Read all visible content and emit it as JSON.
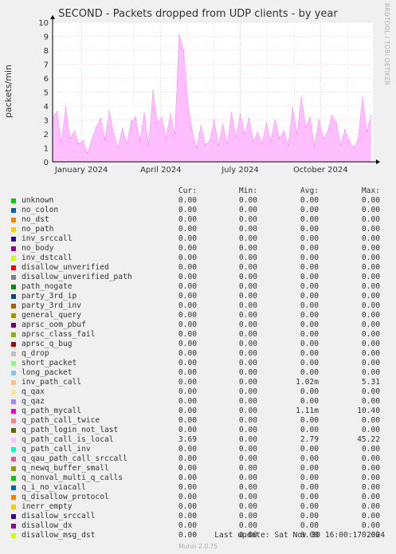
{
  "title": "SECOND - Packets dropped from UDP clients - by year",
  "watermark": "RRDTOOL / TOBI OETIKER",
  "footer": {
    "last_update": "Last update: Sat Nov 30 16:00:17 2024",
    "munin": "Munin 2.0.75"
  },
  "legend": {
    "headers": {
      "cur": "Cur:",
      "min": "Min:",
      "avg": "Avg:",
      "max": "Max:"
    },
    "rows": [
      {
        "name": "unknown",
        "color": "#00cc00",
        "cur": "0.00",
        "min": "0.00",
        "avg": "0.00",
        "max": "0.00"
      },
      {
        "name": "no_colon",
        "color": "#0066b3",
        "cur": "0.00",
        "min": "0.00",
        "avg": "0.00",
        "max": "0.00"
      },
      {
        "name": "no_dst",
        "color": "#ff8000",
        "cur": "0.00",
        "min": "0.00",
        "avg": "0.00",
        "max": "0.00"
      },
      {
        "name": "no_path",
        "color": "#ffcc00",
        "cur": "0.00",
        "min": "0.00",
        "avg": "0.00",
        "max": "0.00"
      },
      {
        "name": "inv_srccall",
        "color": "#330099",
        "cur": "0.00",
        "min": "0.00",
        "avg": "0.00",
        "max": "0.00"
      },
      {
        "name": "no_body",
        "color": "#990099",
        "cur": "0.00",
        "min": "0.00",
        "avg": "0.00",
        "max": "0.00"
      },
      {
        "name": "inv_dstcall",
        "color": "#ccff00",
        "cur": "0.00",
        "min": "0.00",
        "avg": "0.00",
        "max": "0.00"
      },
      {
        "name": "disallow_unverified",
        "color": "#ff0000",
        "cur": "0.00",
        "min": "0.00",
        "avg": "0.00",
        "max": "0.00"
      },
      {
        "name": "disallow_unverified_path",
        "color": "#808080",
        "cur": "0.00",
        "min": "0.00",
        "avg": "0.00",
        "max": "0.00"
      },
      {
        "name": "path_nogate",
        "color": "#008f00",
        "cur": "0.00",
        "min": "0.00",
        "avg": "0.00",
        "max": "0.00"
      },
      {
        "name": "party_3rd_ip",
        "color": "#00487d",
        "cur": "0.00",
        "min": "0.00",
        "avg": "0.00",
        "max": "0.00"
      },
      {
        "name": "party_3rd_inv",
        "color": "#b35a00",
        "cur": "0.00",
        "min": "0.00",
        "avg": "0.00",
        "max": "0.00"
      },
      {
        "name": "general_query",
        "color": "#b38f00",
        "cur": "0.00",
        "min": "0.00",
        "avg": "0.00",
        "max": "0.00"
      },
      {
        "name": "aprsc_oom_pbuf",
        "color": "#6b006b",
        "cur": "0.00",
        "min": "0.00",
        "avg": "0.00",
        "max": "0.00"
      },
      {
        "name": "aprsc_class_fail",
        "color": "#8fb300",
        "cur": "0.00",
        "min": "0.00",
        "avg": "0.00",
        "max": "0.00"
      },
      {
        "name": "aprsc_q_bug",
        "color": "#b30000",
        "cur": "0.00",
        "min": "0.00",
        "avg": "0.00",
        "max": "0.00"
      },
      {
        "name": "q_drop",
        "color": "#bebebe",
        "cur": "0.00",
        "min": "0.00",
        "avg": "0.00",
        "max": "0.00"
      },
      {
        "name": "short_packet",
        "color": "#80ff80",
        "cur": "0.00",
        "min": "0.00",
        "avg": "0.00",
        "max": "0.00"
      },
      {
        "name": "long_packet",
        "color": "#80c9ff",
        "cur": "0.00",
        "min": "0.00",
        "avg": "0.00",
        "max": "0.00"
      },
      {
        "name": "inv_path_call",
        "color": "#ffc080",
        "cur": "0.00",
        "min": "0.00",
        "avg": "1.02m",
        "max": "5.31"
      },
      {
        "name": "q_qax",
        "color": "#ffe680",
        "cur": "0.00",
        "min": "0.00",
        "avg": "0.00",
        "max": "0.00"
      },
      {
        "name": "q_qaz",
        "color": "#aa80ff",
        "cur": "0.00",
        "min": "0.00",
        "avg": "0.00",
        "max": "0.00"
      },
      {
        "name": "q_path_mycall",
        "color": "#ee00cc",
        "cur": "0.00",
        "min": "0.00",
        "avg": "1.11m",
        "max": "10.40"
      },
      {
        "name": "q_path_call_twice",
        "color": "#ff8080",
        "cur": "0.00",
        "min": "0.00",
        "avg": "0.00",
        "max": "0.00"
      },
      {
        "name": "q_path_login_not_last",
        "color": "#666600",
        "cur": "0.00",
        "min": "0.00",
        "avg": "0.00",
        "max": "0.00"
      },
      {
        "name": "q_path_call_is_local",
        "color": "#ffbfff",
        "cur": "3.69",
        "min": "0.00",
        "avg": "2.79",
        "max": "45.22"
      },
      {
        "name": "q_path_call_inv",
        "color": "#00ffcc",
        "cur": "0.00",
        "min": "0.00",
        "avg": "0.00",
        "max": "0.00"
      },
      {
        "name": "q_qau_path_call_srccall",
        "color": "#cc6699",
        "cur": "0.00",
        "min": "0.00",
        "avg": "0.00",
        "max": "0.00"
      },
      {
        "name": "q_newq_buffer_small",
        "color": "#999900",
        "cur": "0.00",
        "min": "0.00",
        "avg": "0.00",
        "max": "0.00"
      },
      {
        "name": "q_nonval_multi_q_calls",
        "color": "#00cc00",
        "cur": "0.00",
        "min": "0.00",
        "avg": "0.00",
        "max": "0.00"
      },
      {
        "name": "q_i_no_viacall",
        "color": "#0066b3",
        "cur": "0.00",
        "min": "0.00",
        "avg": "0.00",
        "max": "0.00"
      },
      {
        "name": "q_disallow_protocol",
        "color": "#ff8000",
        "cur": "0.00",
        "min": "0.00",
        "avg": "0.00",
        "max": "0.00"
      },
      {
        "name": "inerr_empty",
        "color": "#ffcc00",
        "cur": "0.00",
        "min": "0.00",
        "avg": "0.00",
        "max": "0.00"
      },
      {
        "name": "disallow_srccall",
        "color": "#330099",
        "cur": "0.00",
        "min": "0.00",
        "avg": "0.00",
        "max": "0.00"
      },
      {
        "name": "disallow_dx",
        "color": "#990099",
        "cur": "0.00",
        "min": "0.00",
        "avg": "0.00",
        "max": "0.00"
      },
      {
        "name": "disallow_msg_dst",
        "color": "#ccff00",
        "cur": "0.00",
        "min": "0.00",
        "avg": "0.00",
        "max": "0.00"
      }
    ]
  },
  "chart_data": {
    "type": "area",
    "title": "SECOND - Packets dropped from UDP clients - by year",
    "ylabel": "packets/min",
    "xlabel": "",
    "ylim": [
      0,
      10
    ],
    "yticks": [
      0,
      1,
      2,
      3,
      4,
      5,
      6,
      7,
      8,
      9,
      10
    ],
    "xlim": [
      "2023-11-29",
      "2024-11-30"
    ],
    "xticks": [
      {
        "label": "January 2024",
        "date": "2024-01-01"
      },
      {
        "label": "April 2024",
        "date": "2024-04-01"
      },
      {
        "label": "July 2024",
        "date": "2024-07-01"
      },
      {
        "label": "October 2024",
        "date": "2024-10-01"
      }
    ],
    "grid": true,
    "fill_color": "#ffbfff",
    "line_color": "#ff80ff",
    "series": [
      {
        "name": "q_path_call_is_local",
        "points": [
          [
            "2023-11-29",
            3.2
          ],
          [
            "2023-12-04",
            3.6
          ],
          [
            "2023-12-09",
            1.4
          ],
          [
            "2023-12-14",
            3.9
          ],
          [
            "2023-12-19",
            1.7
          ],
          [
            "2023-12-24",
            2.2
          ],
          [
            "2023-12-29",
            1.3
          ],
          [
            "2024-01-03",
            1.5
          ],
          [
            "2024-01-08",
            0.6
          ],
          [
            "2024-01-13",
            1.6
          ],
          [
            "2024-01-18",
            2.5
          ],
          [
            "2024-01-23",
            3.1
          ],
          [
            "2024-01-28",
            1.6
          ],
          [
            "2024-02-02",
            3.6
          ],
          [
            "2024-02-07",
            2.0
          ],
          [
            "2024-02-12",
            1.0
          ],
          [
            "2024-02-17",
            2.4
          ],
          [
            "2024-02-22",
            1.3
          ],
          [
            "2024-02-27",
            2.9
          ],
          [
            "2024-03-03",
            3.2
          ],
          [
            "2024-03-08",
            1.5
          ],
          [
            "2024-03-13",
            3.5
          ],
          [
            "2024-03-18",
            1.2
          ],
          [
            "2024-03-23",
            5.1
          ],
          [
            "2024-03-28",
            2.8
          ],
          [
            "2024-04-02",
            3.2
          ],
          [
            "2024-04-07",
            1.7
          ],
          [
            "2024-04-12",
            3.4
          ],
          [
            "2024-04-17",
            2.0
          ],
          [
            "2024-04-22",
            9.1
          ],
          [
            "2024-04-27",
            8.0
          ],
          [
            "2024-05-02",
            4.2
          ],
          [
            "2024-05-07",
            2.2
          ],
          [
            "2024-05-12",
            1.0
          ],
          [
            "2024-05-17",
            2.6
          ],
          [
            "2024-05-22",
            1.2
          ],
          [
            "2024-05-27",
            1.5
          ],
          [
            "2024-06-01",
            3.0
          ],
          [
            "2024-06-06",
            1.2
          ],
          [
            "2024-06-11",
            2.7
          ],
          [
            "2024-06-16",
            1.3
          ],
          [
            "2024-06-21",
            3.5
          ],
          [
            "2024-06-26",
            1.8
          ],
          [
            "2024-07-01",
            3.4
          ],
          [
            "2024-07-06",
            2.0
          ],
          [
            "2024-07-11",
            3.1
          ],
          [
            "2024-07-16",
            1.5
          ],
          [
            "2024-07-21",
            2.1
          ],
          [
            "2024-07-26",
            1.3
          ],
          [
            "2024-07-31",
            2.8
          ],
          [
            "2024-08-05",
            1.5
          ],
          [
            "2024-08-10",
            3.0
          ],
          [
            "2024-08-15",
            1.7
          ],
          [
            "2024-08-20",
            2.2
          ],
          [
            "2024-08-25",
            1.2
          ],
          [
            "2024-08-30",
            3.9
          ],
          [
            "2024-09-04",
            2.0
          ],
          [
            "2024-09-09",
            4.6
          ],
          [
            "2024-09-14",
            2.5
          ],
          [
            "2024-09-19",
            3.2
          ],
          [
            "2024-09-24",
            1.1
          ],
          [
            "2024-09-29",
            3.0
          ],
          [
            "2024-10-04",
            1.7
          ],
          [
            "2024-10-09",
            2.1
          ],
          [
            "2024-10-14",
            3.3
          ],
          [
            "2024-10-19",
            2.8
          ],
          [
            "2024-10-24",
            1.2
          ],
          [
            "2024-10-29",
            2.3
          ],
          [
            "2024-11-03",
            1.5
          ],
          [
            "2024-11-08",
            1.0
          ],
          [
            "2024-11-13",
            1.6
          ],
          [
            "2024-11-18",
            4.6
          ],
          [
            "2024-11-23",
            2.2
          ],
          [
            "2024-11-28",
            3.3
          ]
        ]
      }
    ]
  }
}
